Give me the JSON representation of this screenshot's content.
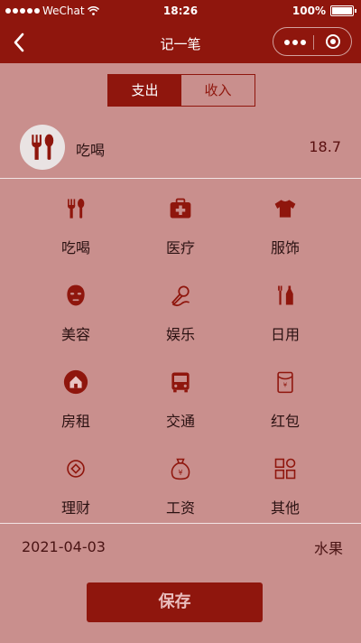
{
  "status_bar": {
    "carrier": "WeChat",
    "time": "18:26",
    "battery": "100%"
  },
  "navbar": {
    "title": "记一笔"
  },
  "segment": {
    "expense": "支出",
    "income": "收入"
  },
  "selected": {
    "category": "吃喝",
    "amount": "18.7",
    "icon": "fork-spoon-icon"
  },
  "categories": [
    {
      "label": "吃喝",
      "icon": "fork-spoon-icon"
    },
    {
      "label": "医疗",
      "icon": "medical-kit-icon"
    },
    {
      "label": "服饰",
      "icon": "tshirt-icon"
    },
    {
      "label": "美容",
      "icon": "face-mask-icon"
    },
    {
      "label": "娱乐",
      "icon": "microphone-icon"
    },
    {
      "label": "日用",
      "icon": "toothbrush-icon"
    },
    {
      "label": "房租",
      "icon": "house-icon"
    },
    {
      "label": "交通",
      "icon": "bus-icon"
    },
    {
      "label": "红包",
      "icon": "red-envelope-icon"
    },
    {
      "label": "理财",
      "icon": "coin-icon"
    },
    {
      "label": "工资",
      "icon": "money-bag-icon"
    },
    {
      "label": "其他",
      "icon": "grid-icon"
    }
  ],
  "footer": {
    "date": "2021-04-03",
    "note": "水果",
    "save_label": "保存"
  },
  "colors": {
    "brand": "#8f160d",
    "background": "#c98f8d"
  }
}
